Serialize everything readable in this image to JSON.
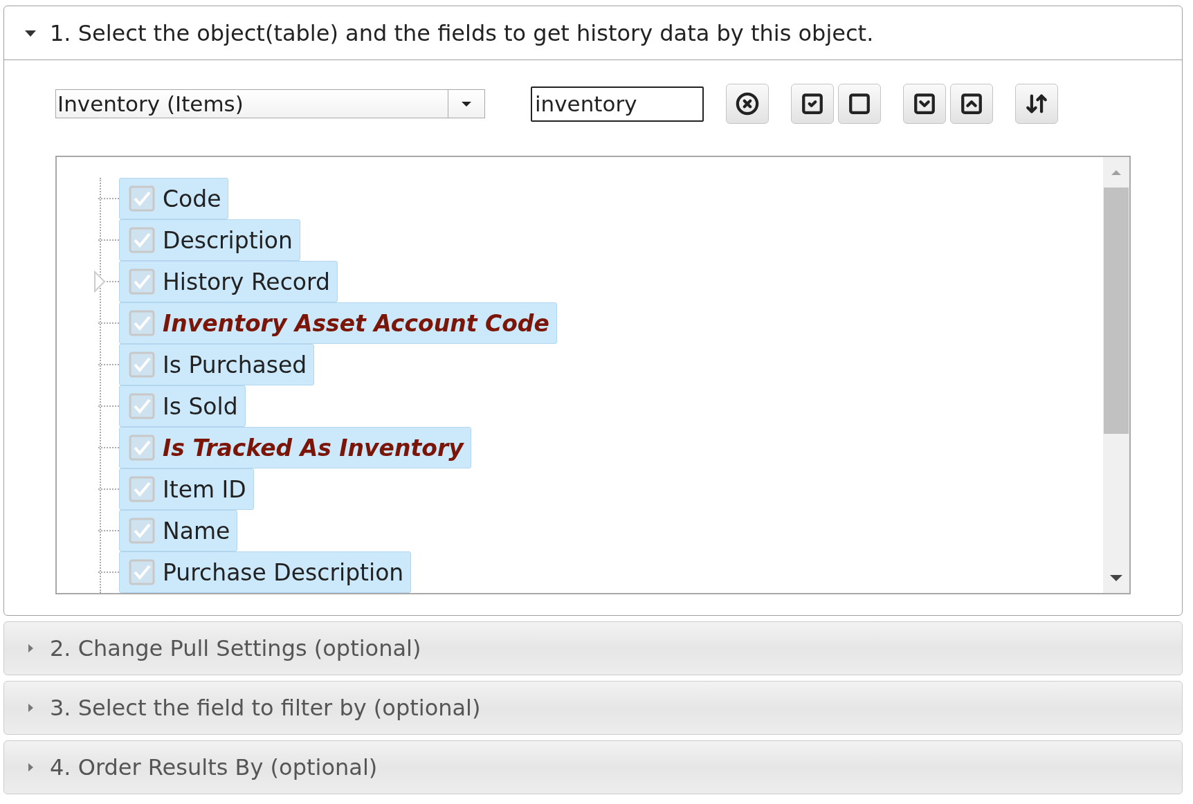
{
  "sections": [
    {
      "title": "1. Select the object(table) and the fields to get history data by this object.",
      "expanded": true
    },
    {
      "title": "2. Change Pull Settings (optional)",
      "expanded": false
    },
    {
      "title": "3. Select the field to filter by (optional)",
      "expanded": false
    },
    {
      "title": "4. Order Results By (optional)",
      "expanded": false
    }
  ],
  "object_select": {
    "value": "Inventory (Items)"
  },
  "search": {
    "value": "inventory"
  },
  "toolbar": [
    {
      "kind": "clear"
    },
    {
      "kind": "check_all"
    },
    {
      "kind": "uncheck_all"
    },
    {
      "kind": "expand_all"
    },
    {
      "kind": "collapse_all"
    },
    {
      "kind": "sort"
    }
  ],
  "fields": [
    {
      "label": "Code",
      "checked": true,
      "highlighted": false,
      "expandable": false
    },
    {
      "label": "Description",
      "checked": true,
      "highlighted": false,
      "expandable": false
    },
    {
      "label": "History Record",
      "checked": true,
      "highlighted": false,
      "expandable": true
    },
    {
      "label": "Inventory Asset Account Code",
      "checked": true,
      "highlighted": true,
      "expandable": false
    },
    {
      "label": "Is Purchased",
      "checked": true,
      "highlighted": false,
      "expandable": false
    },
    {
      "label": "Is Sold",
      "checked": true,
      "highlighted": false,
      "expandable": false
    },
    {
      "label": "Is Tracked As Inventory",
      "checked": true,
      "highlighted": true,
      "expandable": false
    },
    {
      "label": "Item ID",
      "checked": true,
      "highlighted": false,
      "expandable": false
    },
    {
      "label": "Name",
      "checked": true,
      "highlighted": false,
      "expandable": false
    },
    {
      "label": "Purchase Description",
      "checked": true,
      "highlighted": false,
      "expandable": false
    }
  ]
}
